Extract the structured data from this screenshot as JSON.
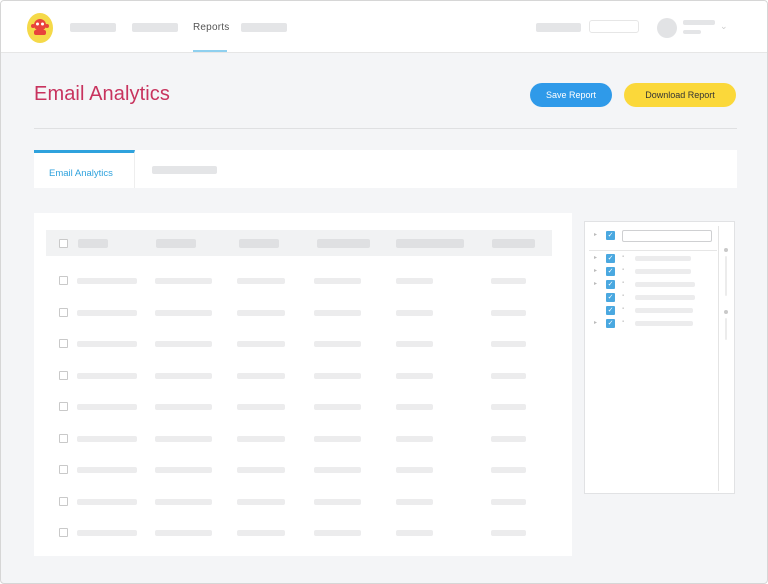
{
  "nav": {
    "active_item": "Reports"
  },
  "header": {
    "title": "Email Analytics",
    "save_label": "Save Report",
    "download_label": "Download Report"
  },
  "tabs": [
    {
      "label": "Email Analytics",
      "active": true
    }
  ],
  "colors": {
    "title": "#c8335e",
    "primary": "#2f9ae9",
    "accent": "#fbd83a",
    "tab_accent": "#2fa2dd"
  },
  "icons": {
    "logo": "monkey-logo-icon",
    "check": "checkbox-checked-icon"
  }
}
